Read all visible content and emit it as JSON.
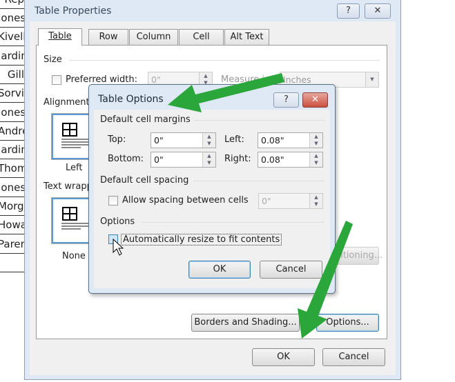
{
  "background_table": {
    "header": "Rep",
    "rows": [
      "Jones",
      "Kivell",
      "Jardine",
      "Gill",
      "Sorvino",
      "Jones",
      "Andrews",
      "Jardine",
      "Thompson",
      "Jones",
      "Morgan",
      "Howard",
      "Parent",
      ""
    ]
  },
  "table_properties": {
    "title": "Table Properties",
    "help_label": "?",
    "close_label": "✕",
    "tabs": [
      {
        "label": "Table",
        "active": true
      },
      {
        "label": "Row"
      },
      {
        "label": "Column"
      },
      {
        "label": "Cell"
      },
      {
        "label": "Alt Text"
      }
    ],
    "size": {
      "heading": "Size",
      "preferred_width_label": "Preferred width:",
      "preferred_width_checked": false,
      "preferred_width_value": "0\"",
      "measure_in_label": "Measure in:",
      "measure_in_value": "Inches"
    },
    "alignment": {
      "heading": "Alignment",
      "left_label": "Left"
    },
    "text_wrapping": {
      "heading": "Text wrapping",
      "none_label": "None"
    },
    "positioning_label": "Positioning...",
    "borders_label": "Borders and Shading...",
    "options_label": "Options...",
    "ok_label": "OK",
    "cancel_label": "Cancel"
  },
  "table_options": {
    "title": "Table Options",
    "help_label": "?",
    "close_label": "✕",
    "margins_heading": "Default cell margins",
    "top_label": "Top:",
    "top_value": "0\"",
    "bottom_label": "Bottom:",
    "bottom_value": "0\"",
    "left_label": "Left:",
    "left_value": "0.08\"",
    "right_label": "Right:",
    "right_value": "0.08\"",
    "spacing_heading": "Default cell spacing",
    "allow_spacing_label": "Allow spacing between cells",
    "allow_spacing_checked": false,
    "spacing_value": "0\"",
    "options_heading": "Options",
    "autoresize_label": "Automatically resize to fit contents",
    "autoresize_checked": false,
    "ok_label": "OK",
    "cancel_label": "Cancel"
  },
  "colors": {
    "annotation_arrow": "#2aa63a",
    "dialog_frame": "#dfe9f5",
    "close_button": "#c9503f"
  }
}
